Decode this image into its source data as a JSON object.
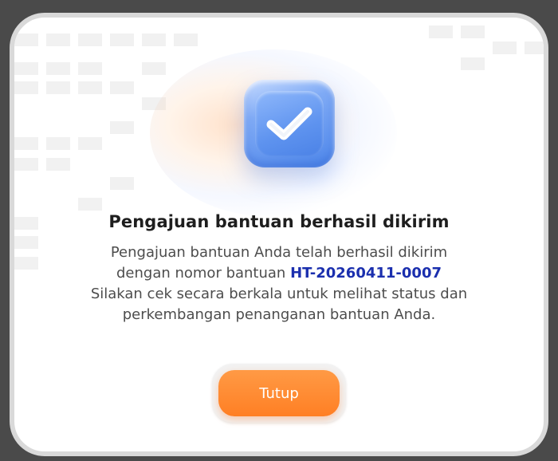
{
  "modal": {
    "title": "Pengajuan bantuan berhasil dikirim",
    "description": {
      "line1": "Pengajuan bantuan Anda telah berhasil dikirim",
      "line2_prefix": "dengan nomor bantuan ",
      "ticket_number": "HT-20260411-0007",
      "line3": "Silakan cek secara berkala untuk melihat status dan",
      "line4": "perkembangan penanganan bantuan Anda."
    },
    "close_button_label": "Tutup",
    "icon": "check-icon"
  },
  "colors": {
    "accent_orange": "#ff8a32",
    "ticket_blue": "#1b2fae",
    "icon_blue": "#5e93ef"
  }
}
